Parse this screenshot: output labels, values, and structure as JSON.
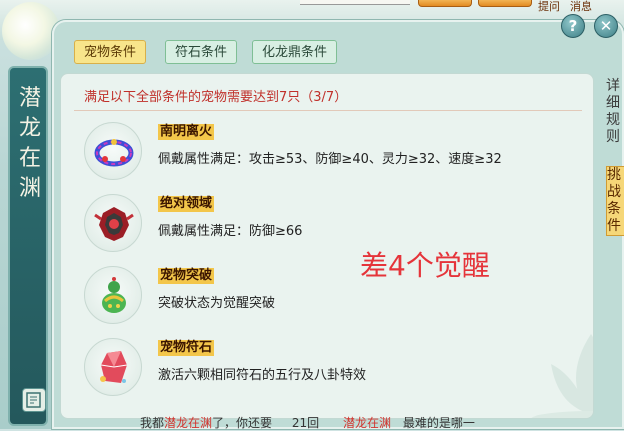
{
  "top_bar": {
    "buttons": [
      "提问",
      "消息"
    ]
  },
  "banner": {
    "title": "潜龙在渊"
  },
  "tabs": [
    {
      "label": "宠物条件",
      "active": true
    },
    {
      "label": "符石条件",
      "active": false
    },
    {
      "label": "化龙鼎条件",
      "active": false
    }
  ],
  "controls": {
    "help": "?",
    "close": "✕"
  },
  "requirement_header": "满足以下全部条件的宠物需要达到7只（3/7）",
  "conditions": [
    {
      "icon": "blue-flame-wreath-icon",
      "title": "南明离火",
      "desc": "佩戴属性满足：攻击≥53、防御≥40、灵力≥32、速度≥32"
    },
    {
      "icon": "red-crest-icon",
      "title": "绝对领域",
      "desc": "佩戴属性满足：防御≥66"
    },
    {
      "icon": "green-gourd-icon",
      "title": "宠物突破",
      "desc": "突破状态为觉醒突破"
    },
    {
      "icon": "red-crystal-icon",
      "title": "宠物符石",
      "desc": "激活六颗相同符石的五行及八卦特效"
    }
  ],
  "annotation": "差4个觉醒",
  "right_tabs": [
    {
      "label": "详细规则",
      "active": false
    },
    {
      "label": "挑战条件",
      "active": true
    }
  ],
  "chat": {
    "prefix": "我都",
    "highlight": "潜龙在渊",
    "text1": "了，你还要",
    "num": "21回",
    "highlight2": "潜龙在渊",
    "text2": "最难的是哪一"
  },
  "colors": {
    "accent_red": "#c0302a",
    "annotation_red": "#e5343a",
    "title_bg": "#f3c64a"
  }
}
